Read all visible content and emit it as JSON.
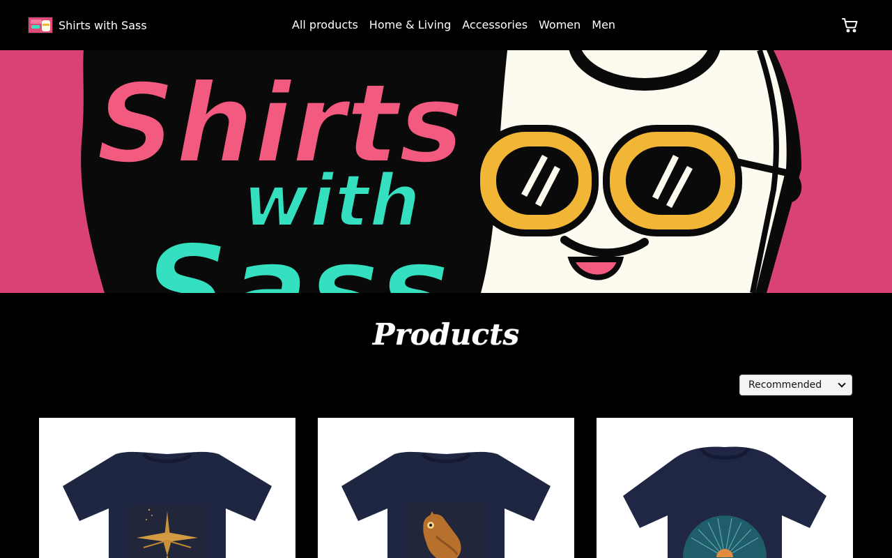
{
  "header": {
    "brand_name": "Shirts with Sass",
    "nav": [
      "All products",
      "Home & Living",
      "Accessories",
      "Women",
      "Men"
    ],
    "cart_icon": "cart-icon"
  },
  "hero": {
    "banner_text": [
      "Shirts",
      "with",
      "Sass"
    ],
    "colors": {
      "background": "#d84373",
      "pink": "#f25a80",
      "teal": "#35e0c1",
      "glasses": "#f2b636",
      "shirt": "#fdfbf0"
    }
  },
  "main": {
    "heading": "Products",
    "sort": {
      "selected": "Recommended"
    }
  },
  "products": [
    {
      "name": "navy-tshirt-compass-design",
      "shirt_color": "#1f2642",
      "graphic": "compass"
    },
    {
      "name": "navy-tshirt-owl-design",
      "shirt_color": "#1f2642",
      "graphic": "owl"
    },
    {
      "name": "navy-tshirt-sunrise-design",
      "shirt_color": "#1f2744",
      "graphic": "sunrise"
    }
  ]
}
